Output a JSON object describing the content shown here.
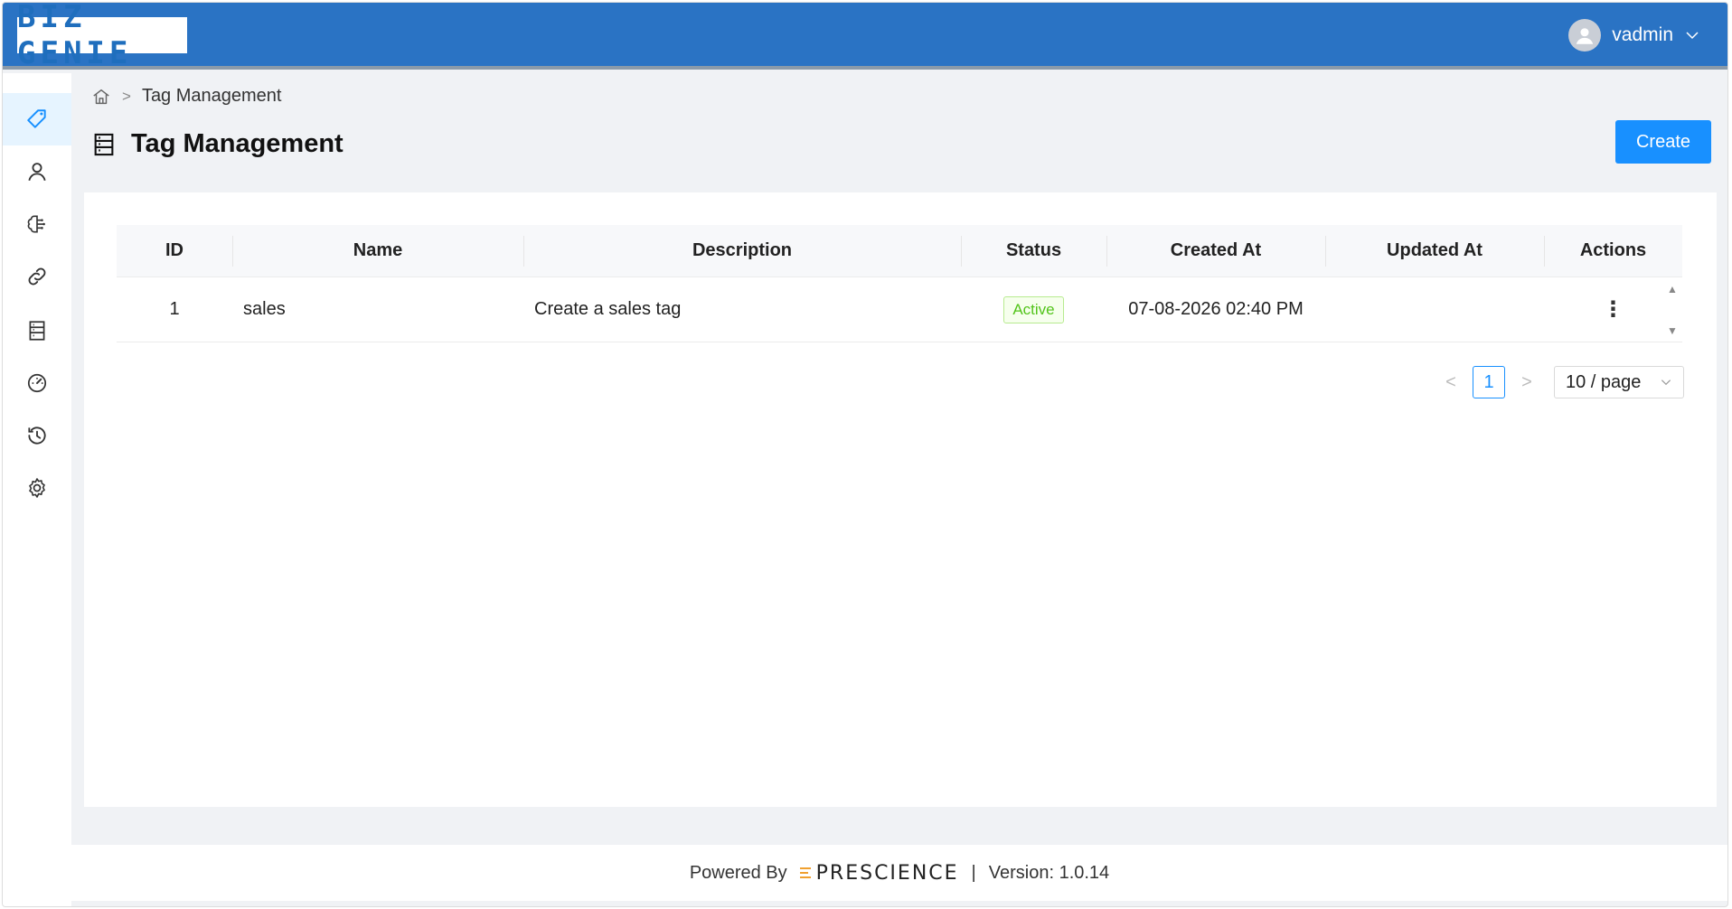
{
  "app": {
    "logo_text": "BIZ GENIE"
  },
  "header": {
    "username": "vadmin"
  },
  "sidebar": {
    "items": [
      {
        "icon": "tag-icon",
        "active": true
      },
      {
        "icon": "user-icon",
        "active": false
      },
      {
        "icon": "brain-icon",
        "active": false
      },
      {
        "icon": "link-icon",
        "active": false
      },
      {
        "icon": "database-icon",
        "active": false
      },
      {
        "icon": "dashboard-icon",
        "active": false
      },
      {
        "icon": "history-icon",
        "active": false
      },
      {
        "icon": "gear-icon",
        "active": false
      }
    ]
  },
  "breadcrumb": {
    "separator": ">",
    "current": "Tag Management"
  },
  "page": {
    "title": "Tag Management",
    "create_label": "Create"
  },
  "table": {
    "columns": [
      "ID",
      "Name",
      "Description",
      "Status",
      "Created At",
      "Updated At",
      "Actions"
    ],
    "rows": [
      {
        "id": "1",
        "name": "sales",
        "description": "Create a sales tag",
        "status": "Active",
        "created_at": "07-08-2026 02:40 PM",
        "updated_at": "",
        "actions": "⋮"
      }
    ]
  },
  "pagination": {
    "prev": "<",
    "current_page": "1",
    "next": ">",
    "page_size": "10 / page"
  },
  "footer": {
    "powered_by": "Powered By",
    "brand": "PRESCIENCE",
    "separator": "|",
    "version": "Version: 1.0.14"
  },
  "colors": {
    "header": "#2a73c4",
    "primary": "#1890ff",
    "active_green": "#52c41a"
  }
}
